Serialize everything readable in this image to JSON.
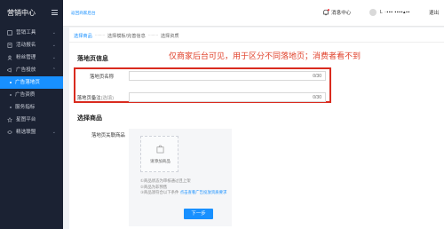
{
  "sidebar": {
    "brand": "营销中心",
    "items": [
      {
        "label": "营销工具",
        "icon": "tool-icon",
        "chevron": true
      },
      {
        "label": "活动报名",
        "icon": "signup-icon",
        "chevron": true
      },
      {
        "label": "粉丝管理",
        "icon": "fans-icon",
        "chevron": true
      },
      {
        "label": "广告投放",
        "icon": "ad-icon",
        "chevron": true
      },
      {
        "label": "广告落地页",
        "sub": true,
        "active": true
      },
      {
        "label": "广告资质",
        "sub": true
      },
      {
        "label": "服务指标",
        "sub": true
      },
      {
        "label": "星图平台",
        "icon": "star-icon"
      },
      {
        "label": "精选联盟",
        "icon": "alliance-icon",
        "chevron": true
      }
    ]
  },
  "header": {
    "back_link": "返回商家后台",
    "message_center": "消息中心",
    "username": "L ·▪▪▪ ▪▪▪▪▴▪▪",
    "logout": "退出"
  },
  "steps": [
    "选择商品",
    "选择模板/完善信息",
    "选择资质"
  ],
  "step_separator": "·········",
  "landing_section": {
    "title": "落地页信息",
    "annotation": "仅商家后台可见，用于区分不同落地页；消费者看不到",
    "name_label": "落地页名称",
    "name_count": "0/30",
    "remark_label": "落地页备注",
    "remark_optional": "(选填)",
    "remark_count": "0/30"
  },
  "product_section": {
    "title": "选择商品",
    "field_label": "落地页关联商品",
    "add_label": "请添加商品",
    "notes": [
      "①商品状态为审核通过且上架",
      "②商品为非预售",
      "③商品须符合以下条件"
    ],
    "notes_link": "点击查看广告投放资质要求"
  },
  "next_button": "下一步",
  "colors": {
    "primary": "#1890ff",
    "sidebar_bg": "#1b2233",
    "annotation": "#e0402a",
    "redbox": "#d92b1f"
  }
}
